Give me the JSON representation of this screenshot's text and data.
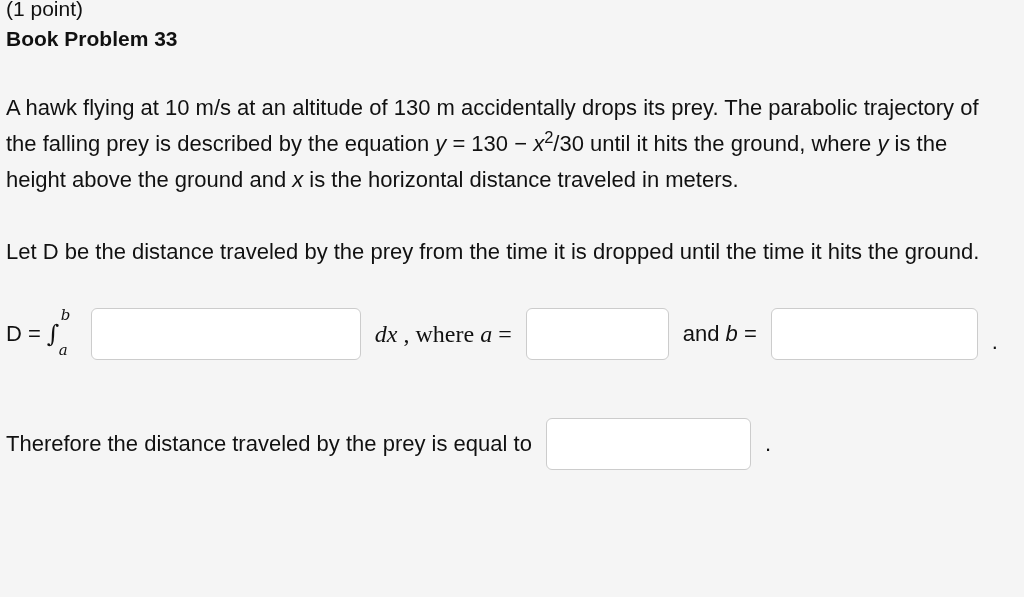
{
  "header": {
    "points": "(1 point)",
    "title": "Book Problem 33"
  },
  "paragraphs": [
    "A hawk flying at 10 m/s at an altitude of 130 m accidentally drops its prey. The parabolic trajectory of the falling prey is described by the equation *y* = 130 − *x*$^{2}$/30   until it hits the ground, where *y* is the height above the ground and *x* is the horizontal distance traveled in meters.",
    "Let D be the distance traveled by the prey from the time it is dropped until the time it hits the ground."
  ],
  "formula": {
    "lhs": "D =",
    "integral": "∫",
    "upper": "b",
    "lower": "a",
    "dx": "*dx* , where *a* =",
    "and": "and *b* =",
    "period": "."
  },
  "conclusion": {
    "text": "Therefore the distance traveled by the prey is equal to",
    "period": "."
  }
}
